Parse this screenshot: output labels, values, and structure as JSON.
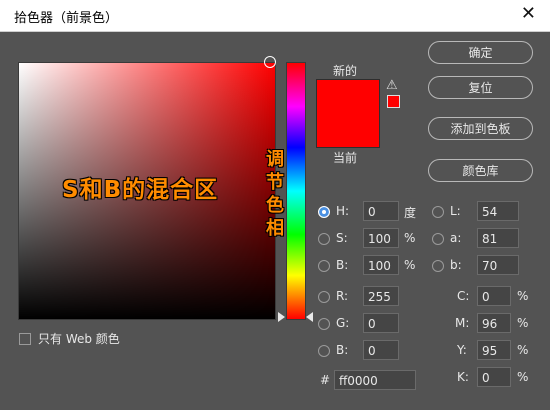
{
  "window": {
    "title": "拾色器（前景色）",
    "close_glyph": "✕"
  },
  "annotations": {
    "sb_field": "S和B的混合区",
    "hue_bar": "调节色相"
  },
  "swatches": {
    "new_label": "新的",
    "current_label": "当前",
    "new_color": "#ff0000",
    "current_color": "#ff0000",
    "warn_icon": "warning-icon"
  },
  "buttons": {
    "ok": "确定",
    "reset": "复位",
    "add_to_swatches": "添加到色板",
    "color_libraries": "颜色库"
  },
  "hsb": {
    "h_label": "H:",
    "h_value": "0",
    "h_unit": "度",
    "s_label": "S:",
    "s_value": "100",
    "s_unit": "%",
    "b_label": "B:",
    "b_value": "100",
    "b_unit": "%"
  },
  "lab": {
    "l_label": "L:",
    "l_value": "54",
    "a_label": "a:",
    "a_value": "81",
    "b_label": "b:",
    "b_value": "70"
  },
  "rgb": {
    "r_label": "R:",
    "r_value": "255",
    "g_label": "G:",
    "g_value": "0",
    "b_label": "B:",
    "b_value": "0"
  },
  "cmyk": {
    "c_label": "C:",
    "c_value": "0",
    "c_unit": "%",
    "m_label": "M:",
    "m_value": "96",
    "m_unit": "%",
    "y_label": "Y:",
    "y_value": "95",
    "y_unit": "%",
    "k_label": "K:",
    "k_value": "0",
    "k_unit": "%"
  },
  "hex": {
    "label": "#",
    "value": "ff0000"
  },
  "web_only": {
    "label": "只有 Web 颜色",
    "checked": false
  }
}
